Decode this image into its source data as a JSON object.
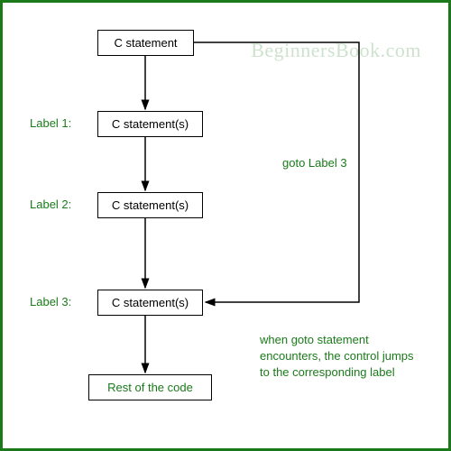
{
  "watermark": "BeginnersBook.com",
  "boxes": {
    "top": "C statement",
    "label1_box": "C statement(s)",
    "label2_box": "C statement(s)",
    "label3_box": "C statement(s)",
    "rest": "Rest of the code"
  },
  "labels": {
    "l1": "Label 1:",
    "l2": "Label 2:",
    "l3": "Label 3:"
  },
  "goto_text": "goto Label 3",
  "description": {
    "line1": "when goto statement",
    "line2": "encounters, the control jumps",
    "line3": "to the corresponding label"
  }
}
